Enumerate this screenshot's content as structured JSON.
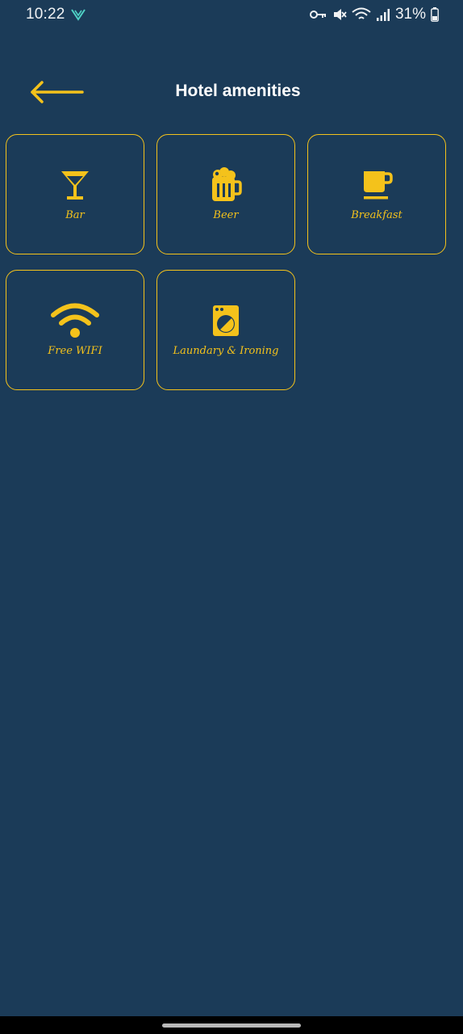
{
  "status_bar": {
    "time": "10:22",
    "battery": "31%"
  },
  "header": {
    "title": "Hotel amenities"
  },
  "amenities": [
    {
      "label": "Bar",
      "icon": "martini-glass-icon"
    },
    {
      "label": "Beer",
      "icon": "beer-mug-icon"
    },
    {
      "label": "Breakfast",
      "icon": "coffee-cup-icon"
    },
    {
      "label": "Free WIFI",
      "icon": "wifi-icon"
    },
    {
      "label": "Laundary & Ironing",
      "icon": "washing-machine-icon"
    }
  ],
  "colors": {
    "background": "#1b3b58",
    "accent": "#f4c21b"
  }
}
